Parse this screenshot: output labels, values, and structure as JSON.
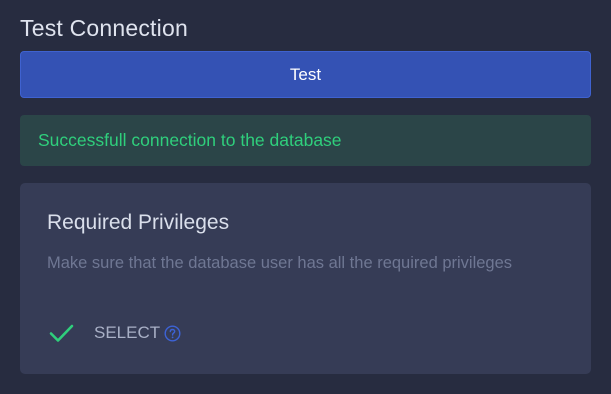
{
  "test_connection": {
    "title": "Test Connection",
    "button_label": "Test"
  },
  "alert": {
    "message": "Successfull connection to the database",
    "status": "success",
    "color": "#2fcf7c"
  },
  "privileges": {
    "title": "Required Privileges",
    "description": "Make sure that the database user has all the required privileges",
    "items": [
      {
        "label": "SELECT",
        "status_icon": "check-icon",
        "has_help": true
      }
    ]
  },
  "colors": {
    "background": "#272c40",
    "primary": "#3452b4",
    "card": "#363c56",
    "success": "#2fcf7c",
    "help": "#3d63d6"
  }
}
